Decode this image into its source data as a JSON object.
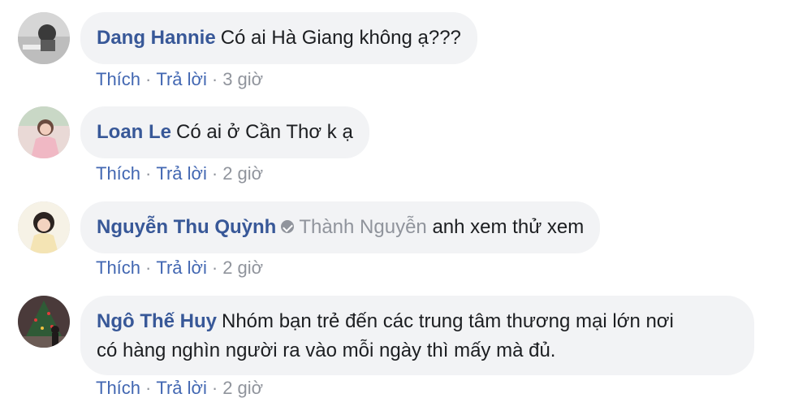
{
  "comments": [
    {
      "author": "Dang Hannie",
      "mention": "",
      "text": "Có ai Hà Giang không ạ???",
      "like_label": "Thích",
      "reply_label": "Trả lời",
      "separator": "·",
      "time": "3 giờ"
    },
    {
      "author": "Loan Le",
      "mention": "",
      "text": "Có ai ở Cần Thơ k ạ",
      "like_label": "Thích",
      "reply_label": "Trả lời",
      "separator": "·",
      "time": "2 giờ"
    },
    {
      "author": "Nguyễn Thu Quỳnh",
      "mention": "Thành Nguyễn",
      "mention_icon": "tag-check-icon",
      "text": "anh xem thử xem",
      "like_label": "Thích",
      "reply_label": "Trả lời",
      "separator": "·",
      "time": "2 giờ"
    },
    {
      "author": "Ngô Thế Huy",
      "mention": "",
      "text_line1": "Nhóm bạn trẻ đến các trung tâm thương mại lớn nơi",
      "text_line2": "có hàng nghìn người ra vào mỗi ngày thì mấy mà đủ.",
      "like_label": "Thích",
      "reply_label": "Trả lời",
      "separator": "·",
      "time": "2 giờ"
    }
  ],
  "colors": {
    "author": "#385898",
    "link": "#4267b2",
    "meta": "#90949c",
    "bubble": "#f2f3f5"
  }
}
